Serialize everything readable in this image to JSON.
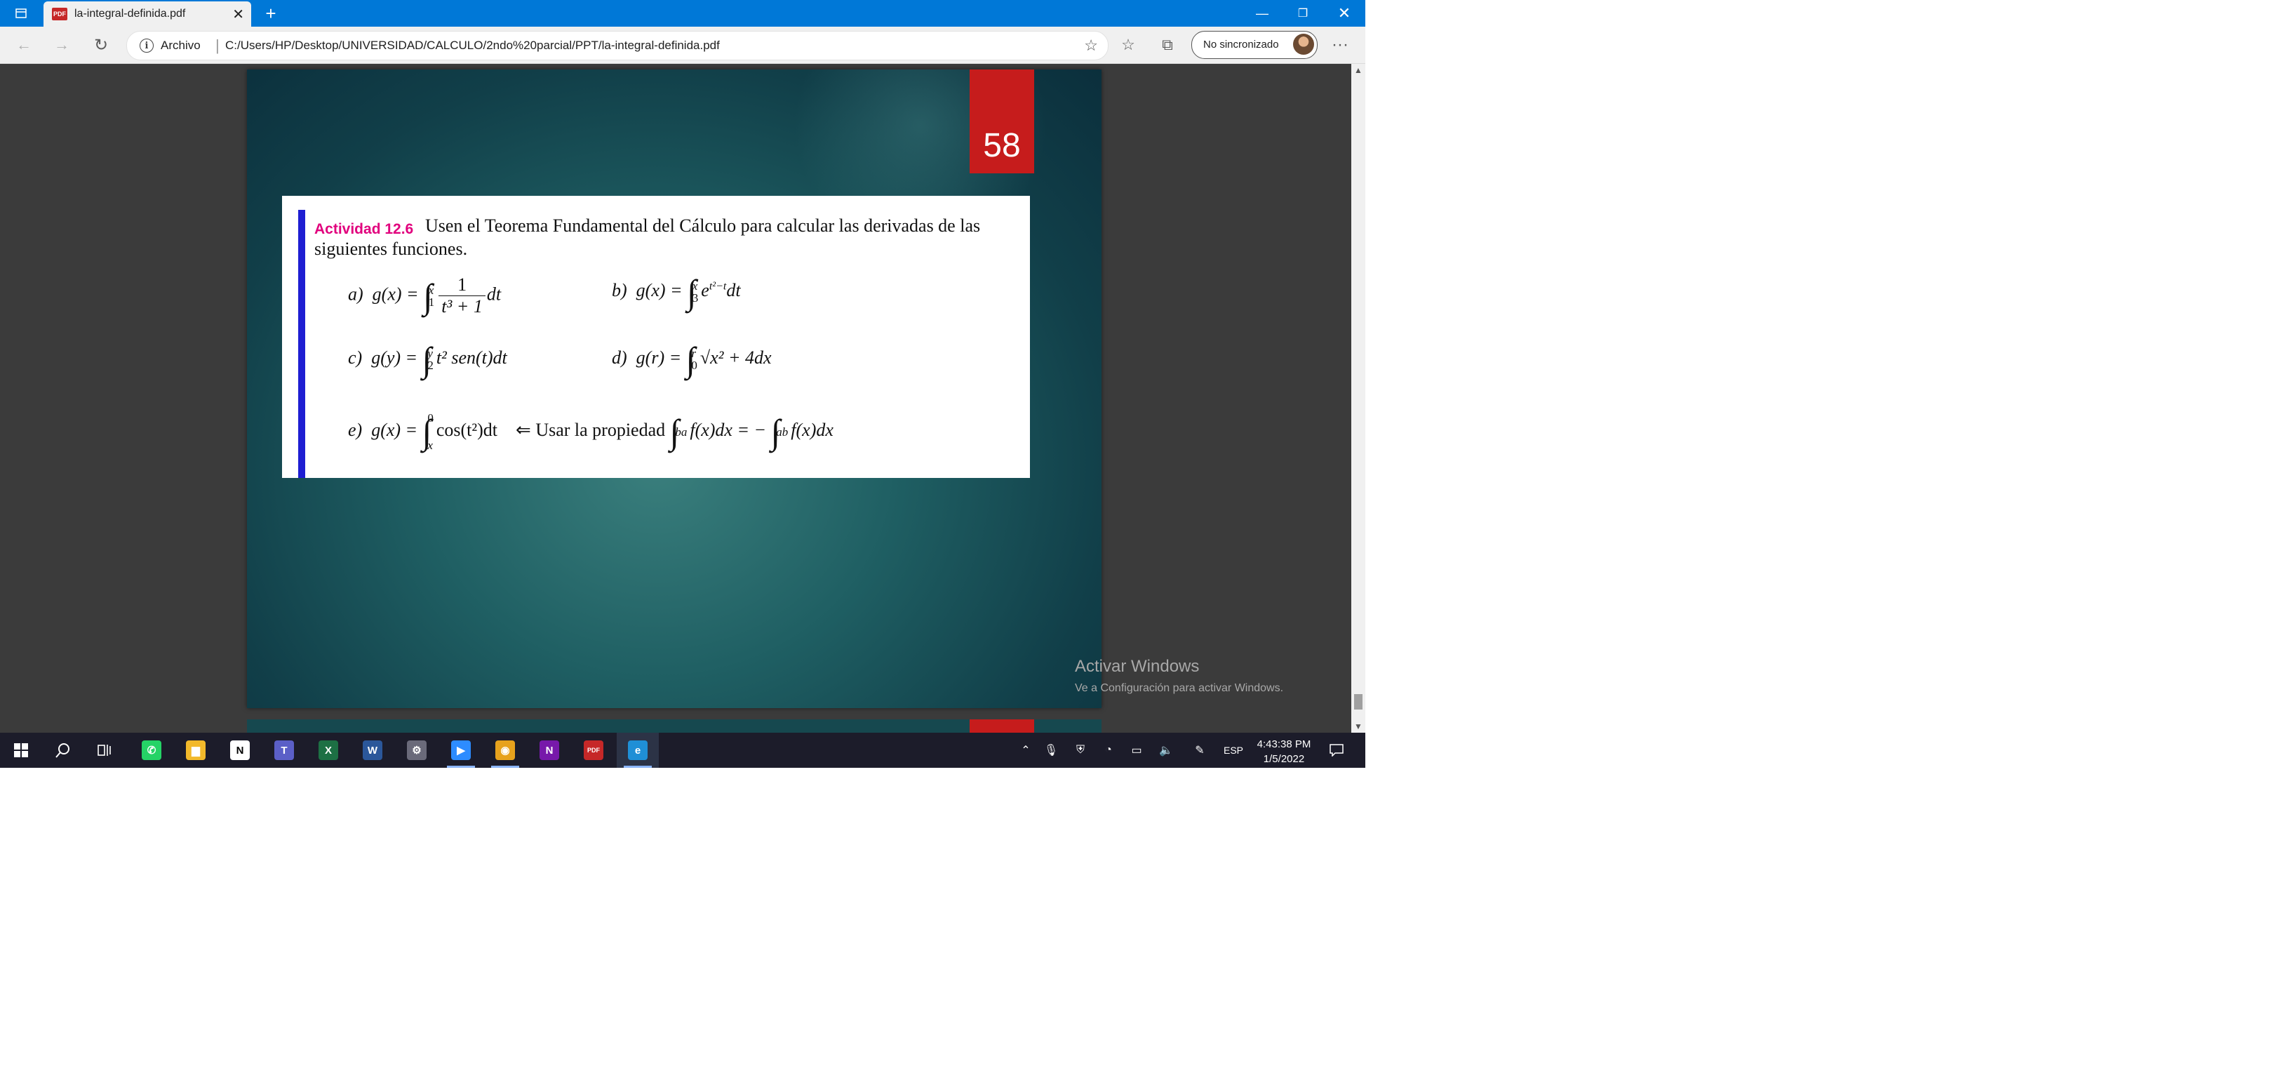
{
  "browser": {
    "tab_title": "la-integral-definida.pdf",
    "tab_close": "✕",
    "new_tab": "+",
    "site_label": "Archivo",
    "url": "C:/Users/HP/Desktop/UNIVERSIDAD/CALCULO/2ndo%20parcial/PPT/la-integral-definida.pdf",
    "profile_label": "No sincronizado",
    "icons": {
      "back": "←",
      "forward": "→",
      "refresh": "↻",
      "favorites": "☆",
      "collections": "⧉",
      "more": "···",
      "minimize": "—",
      "restore": "❐",
      "close": "✕",
      "fav_add": "☆"
    }
  },
  "pdf": {
    "page_number": "58",
    "activity_label": "Actividad 12.6",
    "activity_text": "Usen el Teorema Fundamental del Cálculo para calcular las derivadas de las siguientes funciones.",
    "items": {
      "a_label": "a)",
      "a_lhs": "g(x) =",
      "a_lower": "1",
      "a_upper": "x",
      "a_num": "1",
      "a_den": "t³ + 1",
      "a_diff": "dt",
      "b_label": "b)",
      "b_lhs": "g(x) =",
      "b_lower": "3",
      "b_upper": "x",
      "b_body": "e",
      "b_exp": "t²−t",
      "b_diff": "dt",
      "c_label": "c)",
      "c_lhs": "g(y) =",
      "c_lower": "2",
      "c_upper": "y",
      "c_body": "t² sen(t)dt",
      "d_label": "d)",
      "d_lhs": "g(r) =",
      "d_lower": "0",
      "d_upper": "r",
      "d_body": "√x² + 4dx",
      "e_label": "e)",
      "e_lhs": "g(x) =",
      "e_lower": "x",
      "e_upper": "0",
      "e_body": "cos(t²)dt",
      "e_hint": "⇐ Usar la propiedad",
      "prop_lower1": "a",
      "prop_upper1": "b",
      "prop_body1": "f(x)dx = −",
      "prop_lower2": "b",
      "prop_upper2": "a",
      "prop_body2": "f(x)dx"
    }
  },
  "watermark": {
    "title": "Activar Windows",
    "subtitle": "Ve a Configuración para activar Windows."
  },
  "taskbar": {
    "apps": [
      {
        "name": "whatsapp",
        "glyph": "✆",
        "color": "#25d366"
      },
      {
        "name": "file-explorer",
        "glyph": "▆",
        "color": "#f2b92b"
      },
      {
        "name": "notion",
        "glyph": "N",
        "color": "#ffffff"
      },
      {
        "name": "teams",
        "glyph": "T",
        "color": "#5b5fc7"
      },
      {
        "name": "excel",
        "glyph": "X",
        "color": "#1d7044"
      },
      {
        "name": "word",
        "glyph": "W",
        "color": "#2b579a"
      },
      {
        "name": "settings-app",
        "glyph": "⚙",
        "color": "#6a6a7a"
      },
      {
        "name": "zoom",
        "glyph": "▶",
        "color": "#2d8cff"
      },
      {
        "name": "chrome",
        "glyph": "◉",
        "color": "#e7a21d"
      },
      {
        "name": "onenote",
        "glyph": "N",
        "color": "#7719aa"
      },
      {
        "name": "pdf-reader",
        "glyph": "PDF",
        "color": "#c62828"
      },
      {
        "name": "edge",
        "glyph": "e",
        "color": "#1f8fd6"
      }
    ],
    "language": "ESP",
    "time": "4:43:38 PM",
    "date": "1/5/2022"
  }
}
